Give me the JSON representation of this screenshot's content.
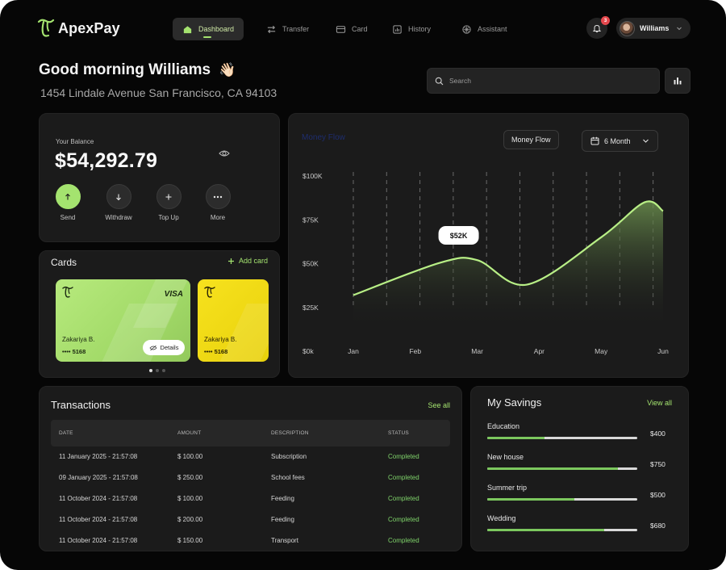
{
  "app": {
    "name": "ApexPay"
  },
  "nav": {
    "items": [
      {
        "label": "Dashboard",
        "icon": "home-icon"
      },
      {
        "label": "Transfer",
        "icon": "transfer-icon"
      },
      {
        "label": "Card",
        "icon": "card-icon"
      },
      {
        "label": "History",
        "icon": "history-icon"
      },
      {
        "label": "Assistant",
        "icon": "assistant-icon"
      }
    ],
    "active": "Dashboard"
  },
  "notifications": {
    "count": "3"
  },
  "user": {
    "name": "Williams"
  },
  "greeting": {
    "title": "Good morning Williams",
    "emoji": "👋🏻",
    "address": "1454 Lindale Avenue San Francisco, CA 94103"
  },
  "search": {
    "placeholder": "Search"
  },
  "balance": {
    "label": "Your Balance",
    "value": "$54,292.79",
    "actions": [
      {
        "label": "Send",
        "icon": "arrow-up-icon"
      },
      {
        "label": "Withdraw",
        "icon": "arrow-down-icon"
      },
      {
        "label": "Top Up",
        "icon": "plus-icon"
      },
      {
        "label": "More",
        "icon": "more-icon"
      }
    ]
  },
  "cards": {
    "title": "Cards",
    "add_label": "Add card",
    "items": [
      {
        "holder": "Zakariya B.",
        "number": "•••• 5168",
        "brand": "VISA",
        "details_label": "Details",
        "color": "#b2e67a"
      },
      {
        "holder": "Zakariya B.",
        "number": "•••• 5168",
        "color": "#f5df16"
      }
    ],
    "page_count": 3,
    "active_page": 1
  },
  "money_flow": {
    "title": "Money Flow",
    "filter_label": "Money Flow",
    "period_label": "6 Month",
    "tooltip_label": "$52K",
    "accent": "#a4e36f"
  },
  "chart_data": {
    "type": "area",
    "categories": [
      "Jan",
      "Feb",
      "Mar",
      "Apr",
      "May",
      "Jun"
    ],
    "y_ticks": [
      "$100K",
      "$75K",
      "$50K",
      "$25K",
      "$0k"
    ],
    "ylim": [
      0,
      100000
    ],
    "series": [
      {
        "values": [
          32000,
          50500,
          52000,
          38000,
          65000,
          85000,
          80000
        ],
        "x": [
          0,
          1.4,
          2,
          2.8,
          4,
          4.7,
          5
        ]
      }
    ],
    "grid": "vertical-dashed",
    "annotation": {
      "label": "$52K",
      "x": 1.7
    }
  },
  "transactions": {
    "title": "Transactions",
    "see_all": "See all",
    "columns": [
      "DATE",
      "AMOUNT",
      "DESCRIPTION",
      "STATUS"
    ],
    "rows": [
      [
        "11 January 2025 - 21:57:08",
        "$ 100.00",
        "Subscription",
        "Completed"
      ],
      [
        "09 January 2025 - 21:57:08",
        "$ 250.00",
        "School fees",
        "Completed"
      ],
      [
        "11 October 2024 - 21:57:08",
        "$ 100.00",
        "Feeding",
        "Completed"
      ],
      [
        "11 October 2024 - 21:57:08",
        "$ 200.00",
        "Feeding",
        "Completed"
      ],
      [
        "11 October 2024 - 21:57:08",
        "$ 150.00",
        "Transport",
        "Completed"
      ]
    ]
  },
  "savings": {
    "title": "My Savings",
    "view_all": "View all",
    "items": [
      {
        "label": "Education",
        "amount": "$400",
        "progress": 0.38
      },
      {
        "label": "New house",
        "amount": "$750",
        "progress": 0.87
      },
      {
        "label": "Summer trip",
        "amount": "$500",
        "progress": 0.58
      },
      {
        "label": "Wedding",
        "amount": "$680",
        "progress": 0.78
      }
    ]
  }
}
